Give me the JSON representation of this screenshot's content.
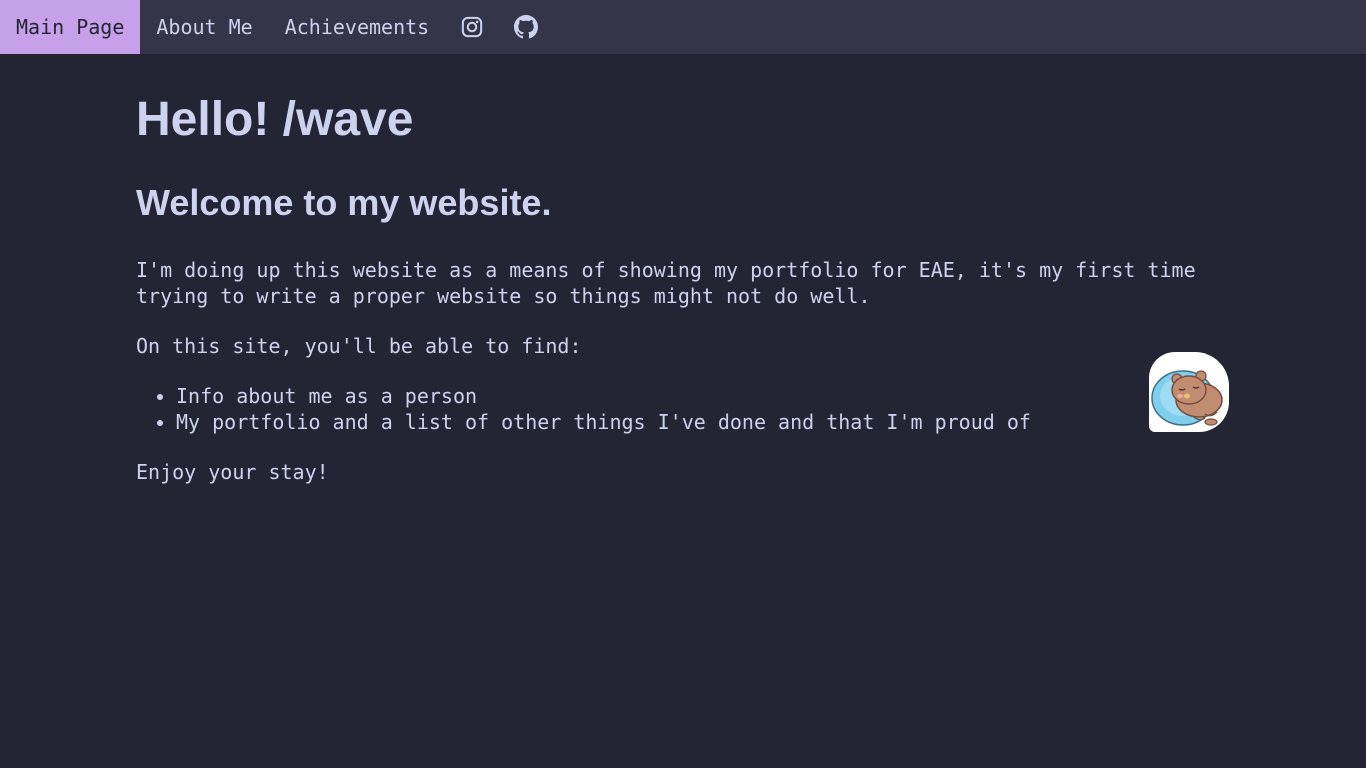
{
  "nav": {
    "items": [
      {
        "label": "Main Page",
        "active": true
      },
      {
        "label": "About Me",
        "active": false
      },
      {
        "label": "Achievements",
        "active": false
      }
    ],
    "icons": [
      "instagram-icon",
      "github-icon"
    ]
  },
  "main": {
    "title": "Hello! /wave",
    "subtitle": "Welcome to my website.",
    "intro": "I'm doing up this website as a means of showing my portfolio for EAE, it's my first time trying to write a proper website so things might not do well.",
    "find_label": "On this site, you'll be able to find:",
    "features": [
      "Info about me as a person",
      "My portfolio and a list of other things I've done and that I'm proud of"
    ],
    "closing": "Enjoy your stay!"
  },
  "colors": {
    "background": "#242534",
    "navbar": "#343549",
    "active_tab": "#c6a0e8",
    "text": "#cdd2ef"
  },
  "sticker": {
    "icon": "sleeping-bear-sticker"
  }
}
